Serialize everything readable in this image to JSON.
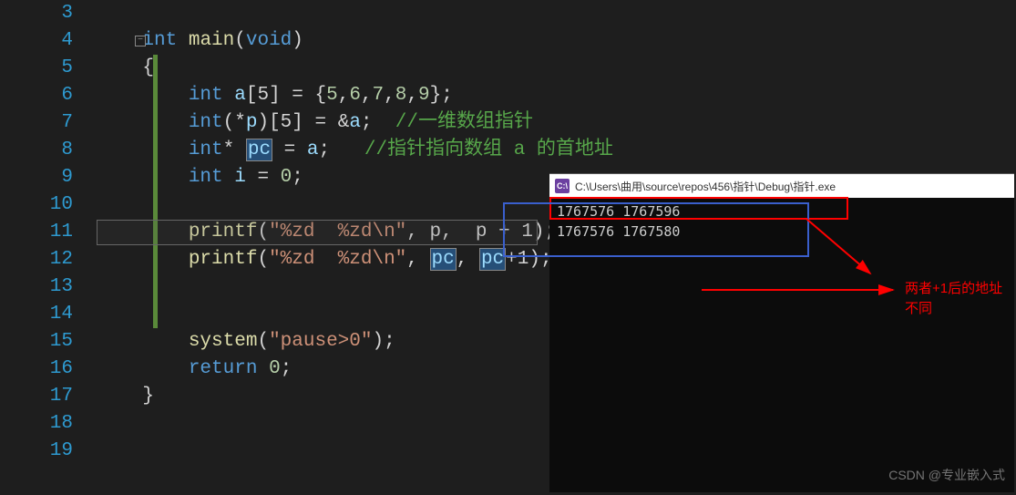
{
  "gutter": {
    "lines": [
      "3",
      "4",
      "5",
      "6",
      "7",
      "8",
      "9",
      "10",
      "11",
      "12",
      "13",
      "14",
      "15",
      "16",
      "17",
      "18",
      "19"
    ]
  },
  "code": {
    "l4": {
      "kw_int": "int",
      "func_main": "main",
      "kw_void": "void"
    },
    "l5": {
      "brace": "{"
    },
    "l6": {
      "kw_int": "int",
      "var_a": "a",
      "dim": "[5]",
      "eq": " = ",
      "arr_open": "{",
      "n1": "5",
      "n2": "6",
      "n3": "7",
      "n4": "8",
      "n5": "9",
      "arr_close": "}"
    },
    "l7": {
      "kw_int": "int",
      "var_p": "p",
      "dim": "[5]",
      "eq": " = ",
      "amp": "&",
      "var_a": "a",
      "comment": "//一维数组指针"
    },
    "l8": {
      "kw_int": "int",
      "var_pc": "pc",
      "eq": " = ",
      "var_a": "a",
      "comment": "//指针指向数组 a 的首地址"
    },
    "l9": {
      "kw_int": "int",
      "var_i": "i",
      "eq": " = ",
      "zero": "0"
    },
    "l11": {
      "kw_printf": "printf",
      "fmt": "\"%zd  %zd\\n\"",
      "args": ", p,  p + 1"
    },
    "l12": {
      "kw_printf": "printf",
      "fmt": "\"%zd  %zd\\n\"",
      "comma1": ", ",
      "var_pc1": "pc",
      "comma2": ", ",
      "var_pc2": "pc",
      "plus1": "+1"
    },
    "l15": {
      "kw_system": "system",
      "arg": "\"pause>0\""
    },
    "l16": {
      "kw_return": "return",
      "zero": "0"
    },
    "l17": {
      "brace": "}"
    }
  },
  "console": {
    "title": "C:\\Users\\曲用\\source\\repos\\456\\指针\\Debug\\指针.exe",
    "line1": "1767576  1767596",
    "line2": "1767576  1767580"
  },
  "annotation": {
    "text1": "两者+1后的地址",
    "text2": "不同"
  },
  "watermark": "CSDN @专业嵌入式"
}
